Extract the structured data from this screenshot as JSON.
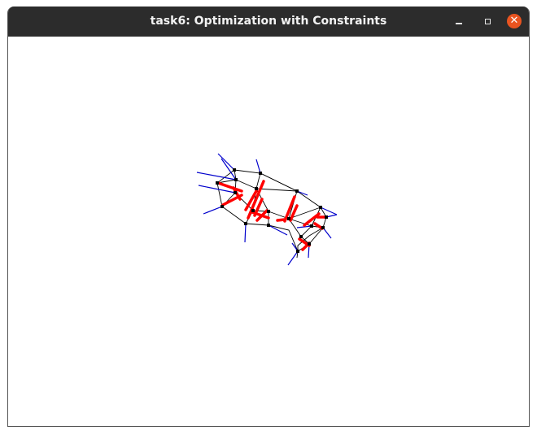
{
  "window": {
    "title": "task6: Optimization with Constraints",
    "controls": {
      "minimize_icon": "minimize-icon",
      "maximize_icon": "maximize-icon",
      "close_icon": "close-icon"
    }
  },
  "colors": {
    "titlebar": "#2c2c2c",
    "close_button": "#e95420",
    "mesh_edge": "#000000",
    "vertex": "#000000",
    "blue_vectors": "#0000cc",
    "red_vectors": "#ff0000"
  }
}
